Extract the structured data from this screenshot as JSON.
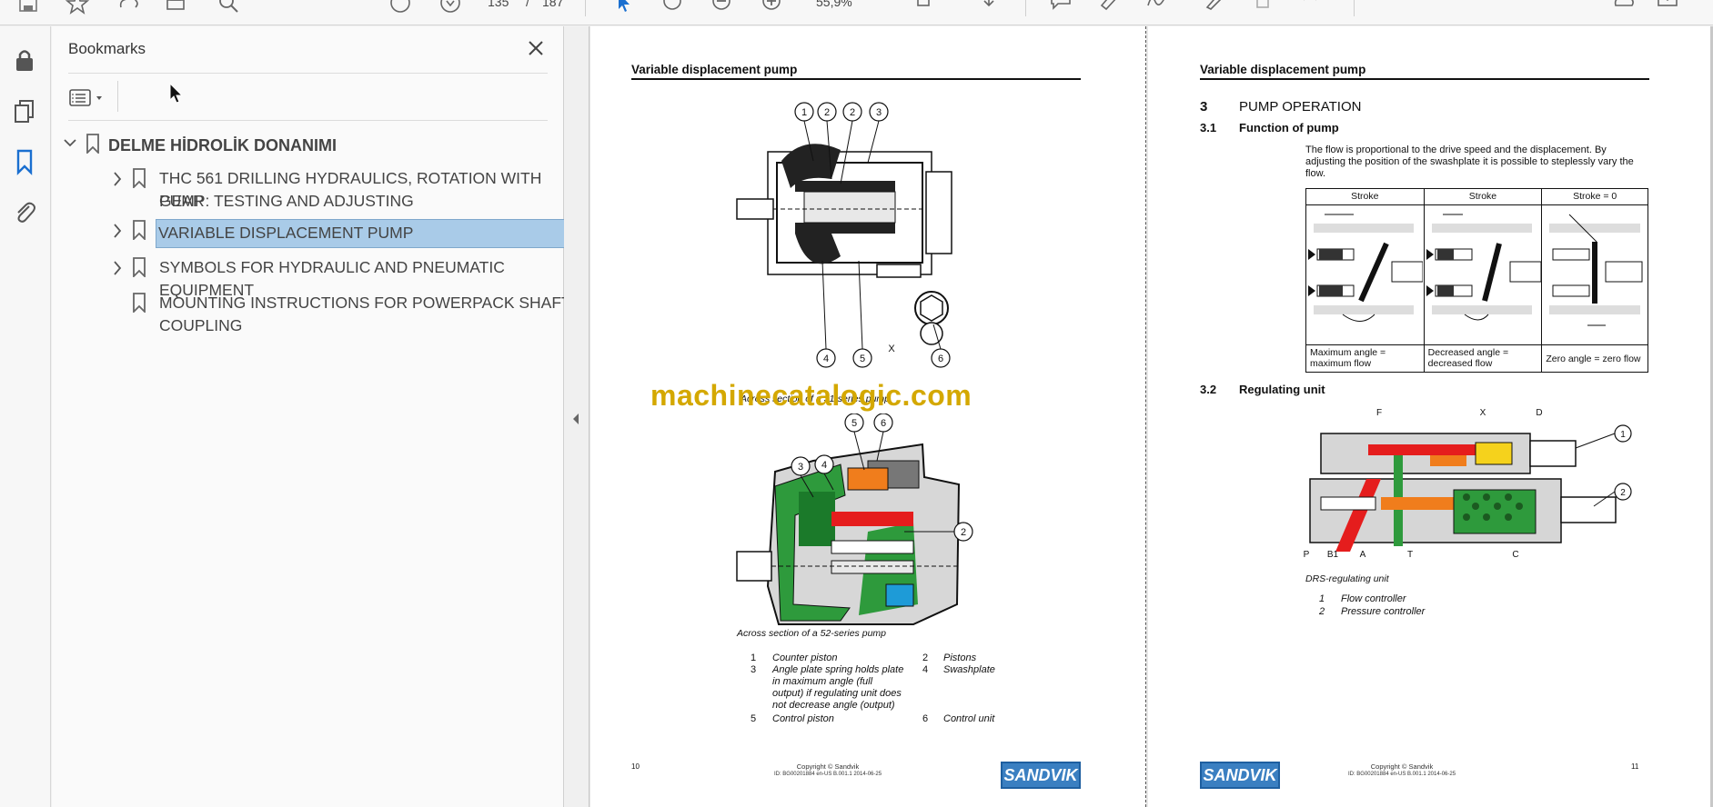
{
  "toolbar": {
    "page_current": "135",
    "page_sep": "/",
    "page_total": "187",
    "zoom": "55,9%"
  },
  "bookmarks_panel": {
    "title": "Bookmarks",
    "root": "DELME HİDROLİK DONANIMI",
    "items": [
      {
        "label_line1": "THC 561 DRILLING HYDRAULICS, ROTATION WITH GEAR",
        "label_line2": "PUMP: TESTING AND ADJUSTING"
      },
      {
        "label_line1": "VARIABLE DISPLACEMENT PUMP",
        "label_line2": ""
      },
      {
        "label_line1": "SYMBOLS FOR HYDRAULIC AND PNEUMATIC EQUIPMENT",
        "label_line2": ""
      },
      {
        "label_line1": "MOUNTING INSTRUCTIONS FOR POWERPACK SHAFT",
        "label_line2": "COUPLING"
      }
    ]
  },
  "page_left": {
    "header": "Variable displacement pump",
    "watermark": "machinecatalogic.com",
    "fig1_caption": "Across section of a 31-series pump",
    "fig2_caption": "Across section of a 52-series pump",
    "fig1_callouts": [
      "1",
      "2",
      "2",
      "3",
      "4",
      "5",
      "6",
      "X"
    ],
    "fig2_callouts": [
      "5",
      "6",
      "3",
      "4",
      "2"
    ],
    "legend": [
      {
        "num": "1",
        "text": "Counter piston"
      },
      {
        "num": "2",
        "text": "Pistons"
      },
      {
        "num": "3",
        "text": "Angle plate spring holds plate in maximum angle (full output) if regulating unit does not decrease angle (output)"
      },
      {
        "num": "4",
        "text": "Swashplate"
      },
      {
        "num": "5",
        "text": "Control piston"
      },
      {
        "num": "6",
        "text": "Control unit"
      }
    ],
    "legend3_lines": [
      "Angle plate spring holds plate",
      "in maximum angle (full",
      "output) if regulating unit does",
      "not decrease angle (output)"
    ],
    "page_number": "10",
    "copyright": "Copyright © Sandvik",
    "doc_id": "ID: BG00201884 en-US B.001.1 2014-06-25",
    "logo": "SANDVIK"
  },
  "page_right": {
    "header": "Variable displacement pump",
    "section_num": "3",
    "section_title": "PUMP OPERATION",
    "sub1_num": "3.1",
    "sub1_title": "Function of pump",
    "body_lines": [
      "The flow is proportional to the drive speed and the displacement. By",
      "adjusting the position of the swashplate it is possible to steplessly vary the",
      "flow."
    ],
    "table_headers": [
      "Stroke",
      "Stroke",
      "Stroke = 0"
    ],
    "table_captions": [
      [
        "Maximum angle =",
        "maximum flow"
      ],
      [
        "Decreased angle =",
        "decreased flow"
      ],
      [
        "Zero angle = zero flow",
        ""
      ]
    ],
    "sub2_num": "3.2",
    "sub2_title": "Regulating unit",
    "reg_labels": [
      "F",
      "X",
      "D",
      "1",
      "2",
      "P",
      "B1",
      "A",
      "T",
      "C"
    ],
    "reg_caption": "DRS-regulating unit",
    "reg_legend": [
      {
        "num": "1",
        "text": "Flow controller"
      },
      {
        "num": "2",
        "text": "Pressure controller"
      }
    ],
    "page_number": "11",
    "copyright": "Copyright © Sandvik",
    "doc_id": "ID: BG00201884 en-US B.001.1 2014-06-25",
    "logo": "SANDVIK"
  }
}
